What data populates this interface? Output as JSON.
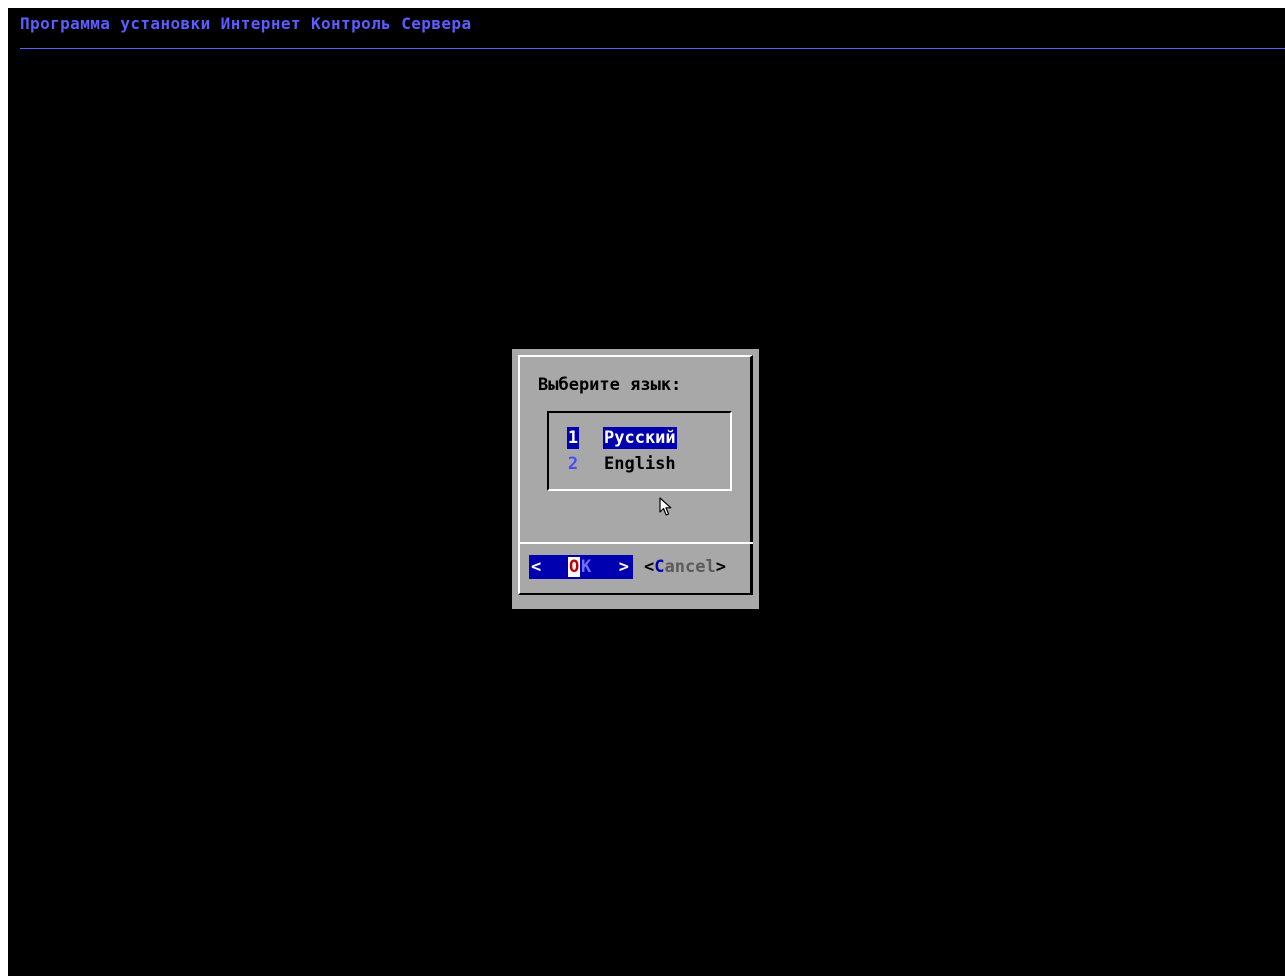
{
  "backtitle": "Программа установки Интернет Контроль Сервера",
  "dialog": {
    "prompt": "Выберите язык:",
    "menu": {
      "items": [
        {
          "tag": "1",
          "label": "Русский",
          "selected": true
        },
        {
          "tag": "2",
          "label": "English",
          "selected": false
        }
      ]
    },
    "buttons": {
      "ok": {
        "left": "<",
        "hotkey": "O",
        "rest": "K",
        "right": ">"
      },
      "cancel": {
        "left": "<",
        "hotkey": "C",
        "rest": "ancel",
        "right": ">"
      }
    }
  },
  "colors": {
    "screen_bg": "#000000",
    "backtitle": "#5c5cff",
    "dialog_bg": "#a8a8a8",
    "selection_bg": "#0000b0",
    "hotkey_red": "#c00000"
  },
  "icons": {
    "cursor": "mouse-pointer-icon"
  }
}
